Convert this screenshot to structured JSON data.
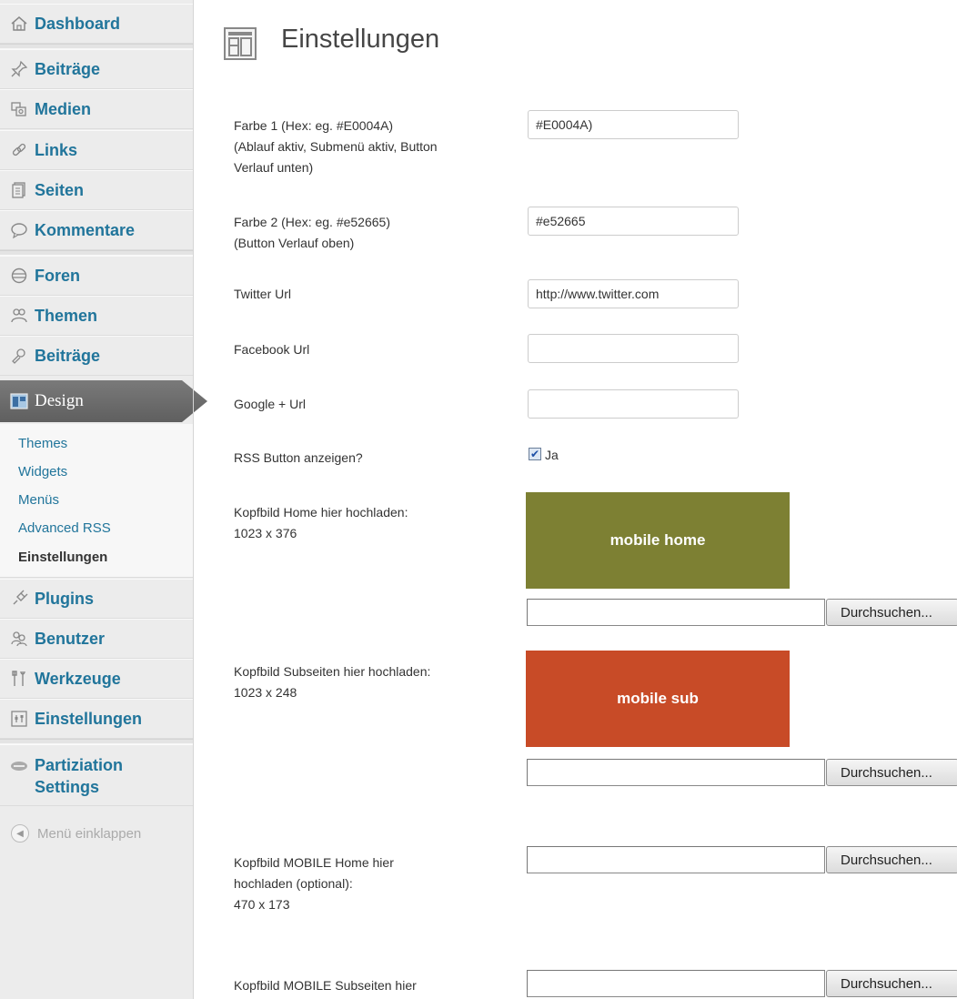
{
  "sidebar": {
    "items": [
      {
        "label": "Dashboard",
        "icon": "dashboard-icon"
      },
      {
        "label": "Beiträge",
        "icon": "pin-icon"
      },
      {
        "label": "Medien",
        "icon": "media-icon"
      },
      {
        "label": "Links",
        "icon": "links-icon"
      },
      {
        "label": "Seiten",
        "icon": "pages-icon"
      },
      {
        "label": "Kommentare",
        "icon": "comments-icon"
      },
      {
        "label": "Foren",
        "icon": "forums-icon"
      },
      {
        "label": "Themen",
        "icon": "topics-icon"
      },
      {
        "label": "Beiträge",
        "icon": "replies-icon"
      },
      {
        "label": "Design",
        "icon": "appearance-icon"
      },
      {
        "label": "Plugins",
        "icon": "plugins-icon"
      },
      {
        "label": "Benutzer",
        "icon": "users-icon"
      },
      {
        "label": "Werkzeuge",
        "icon": "tools-icon"
      },
      {
        "label": "Einstellungen",
        "icon": "settings-icon"
      }
    ],
    "partiziation": {
      "line1": "Partiziation",
      "line2": "Settings"
    },
    "submenu": [
      "Themes",
      "Widgets",
      "Menüs",
      "Advanced RSS",
      "Einstellungen"
    ],
    "collapse_label": "Menü einklappen"
  },
  "page": {
    "title": "Einstellungen"
  },
  "form": {
    "color1": {
      "label_line1": "Farbe 1 (Hex: eg. #E0004A)",
      "label_line2": "(Ablauf aktiv, Submenü aktiv, Button",
      "label_line3": "Verlauf unten)",
      "value": "#E0004A)"
    },
    "color2": {
      "label_line1": "Farbe 2 (Hex: eg. #e52665)",
      "label_line2": "(Button Verlauf oben)",
      "value": "#e52665"
    },
    "twitter": {
      "label": "Twitter Url",
      "value": "http://www.twitter.com"
    },
    "facebook": {
      "label": "Facebook Url",
      "value": ""
    },
    "google": {
      "label": "Google + Url",
      "value": ""
    },
    "rss": {
      "label": "RSS Button anzeigen?",
      "checkbox_label": "Ja",
      "checked": true
    },
    "header_home": {
      "label_line1": "Kopfbild Home hier hochladen:",
      "label_line2": "1023 x 376",
      "preview_text": "mobile home",
      "preview_color": "#7d8033"
    },
    "header_sub": {
      "label_line1": "Kopfbild Subseiten hier hochladen:",
      "label_line2": "1023 x 248",
      "preview_text": "mobile sub",
      "preview_color": "#c84b27"
    },
    "mobile_home": {
      "label_line1": "Kopfbild MOBILE Home hier",
      "label_line2": "hochladen (optional):",
      "label_line3": "470 x 173"
    },
    "mobile_sub": {
      "label_line1": "Kopfbild MOBILE Subseiten hier"
    },
    "browse_label": "Durchsuchen..."
  }
}
